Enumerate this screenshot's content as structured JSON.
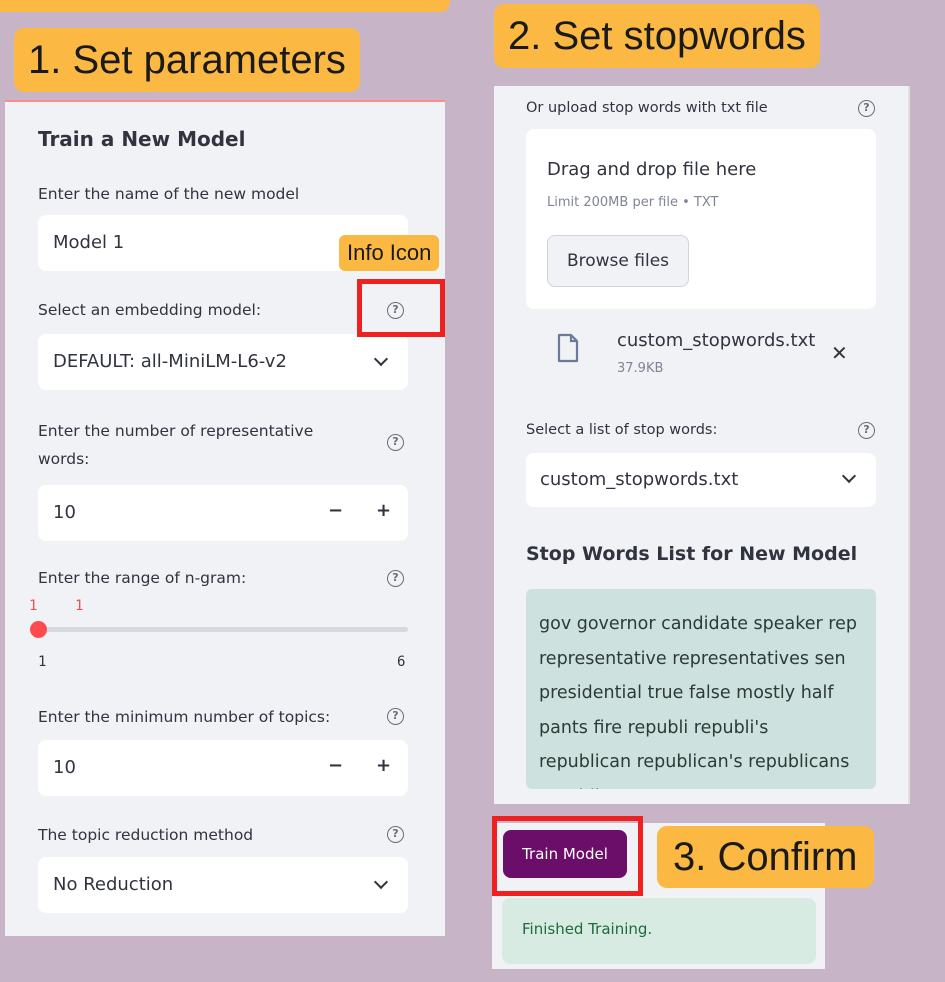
{
  "callouts": {
    "set_parameters": "1. Set parameters",
    "set_stopwords": "2. Set stopwords",
    "confirm": "3. Confirm",
    "info_icon": "Info Icon"
  },
  "left": {
    "heading": "Train a New Model",
    "model_name": {
      "label": "Enter the name of the new model",
      "value": "Model 1"
    },
    "embedding": {
      "label": "Select an embedding model:",
      "value": "DEFAULT: all-MiniLM-L6-v2"
    },
    "rep_words": {
      "label": "Enter the number of representative words:",
      "value": "10"
    },
    "ngram": {
      "label": "Enter the range of n-gram:",
      "low": "1",
      "high": "1",
      "min": "1",
      "max": "6"
    },
    "min_topics": {
      "label": "Enter the minimum number of topics:",
      "value": "10"
    },
    "reduction": {
      "label": "The topic reduction method",
      "value": "No Reduction"
    },
    "help_glyph": "?",
    "minus": "−",
    "plus": "+"
  },
  "right": {
    "upload_label": "Or upload stop words with txt file",
    "drop_text": "Drag and drop file here",
    "limit_text": "Limit 200MB per file • TXT",
    "browse_label": "Browse files",
    "file_name": "custom_stopwords.txt",
    "file_size": "37.9KB",
    "close_glyph": "✕",
    "select_label": "Select a list of stop words:",
    "select_value": "custom_stopwords.txt",
    "list_heading": "Stop Words List for New Model",
    "stopwords_text": "gov governor candidate speaker rep representative representatives sen presidential true false mostly half pants fire republi republi's republican republican's republicans republicans's"
  },
  "actions": {
    "train_button": "Train Model",
    "success_message": "Finished Training."
  },
  "colors": {
    "background": "#c7b5c7",
    "callout": "#fbb944",
    "highlight": "#ef2020",
    "train_button": "#6a0e6a",
    "success": "#d8ebe3",
    "slider": "#ff4b4b"
  }
}
